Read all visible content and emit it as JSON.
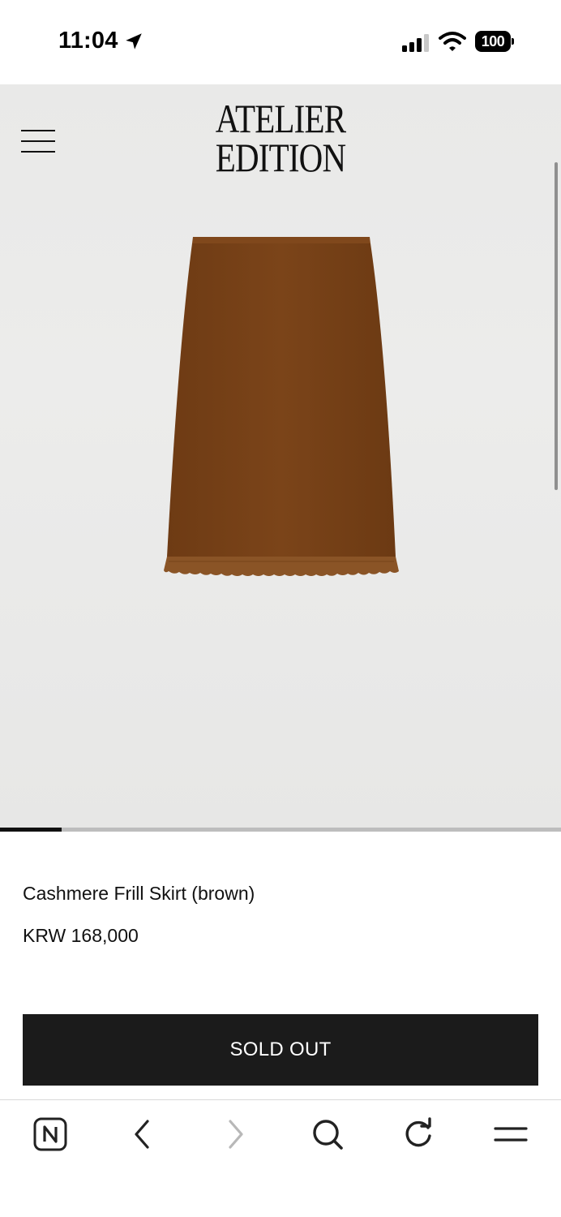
{
  "status_bar": {
    "time": "11:04",
    "battery": "100",
    "icons": [
      "location-arrow-icon",
      "cellular-signal-icon",
      "wifi-icon",
      "battery-icon"
    ]
  },
  "header": {
    "brand_line1": "ATELIER",
    "brand_line2": "EDITION",
    "menu_icon": "hamburger-menu-icon"
  },
  "product": {
    "image": "brown-skirt-product-photo",
    "image_color": "#7a4318",
    "name": "Cashmere Frill Skirt (brown)",
    "price": "KRW 168,000",
    "button_label": "SOLD OUT"
  },
  "carousel": {
    "progress": 0.11
  },
  "browser_toolbar": {
    "icons": [
      "naver-home-icon",
      "back-arrow-icon",
      "forward-arrow-icon",
      "search-icon",
      "reload-icon",
      "menu-icon"
    ]
  },
  "colors": {
    "button_bg": "#1b1b1b",
    "hero_bg": "#ebebea",
    "text": "#111111"
  }
}
